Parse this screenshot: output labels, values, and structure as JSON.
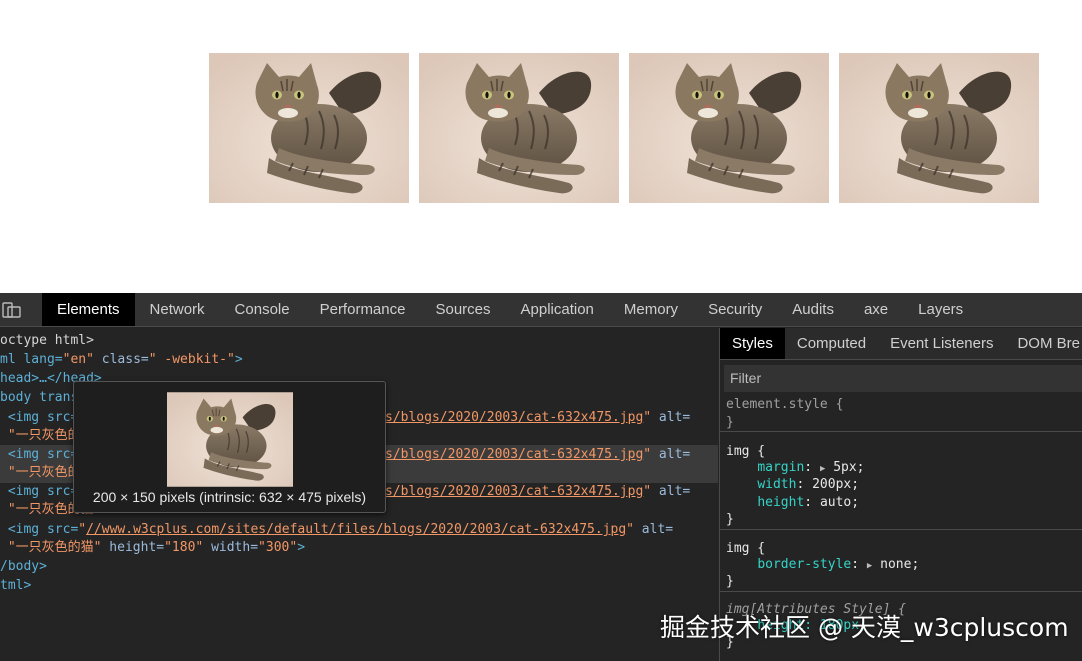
{
  "devtools": {
    "tabs": [
      "Elements",
      "Network",
      "Console",
      "Performance",
      "Sources",
      "Application",
      "Memory",
      "Security",
      "Audits",
      "axe",
      "Layers"
    ],
    "active_tab": "Elements"
  },
  "dom": {
    "line1": "octype html>",
    "line2": {
      "tag": "ml lang=",
      "lang": "\"en\"",
      "cls_attr": " class=",
      "cls_val": "\" -webkit-\"",
      "end": ">"
    },
    "line3": "head>…</head>",
    "line4": "body trans",
    "img_open": "<img src=",
    "img_src_prefix": "\"",
    "url_visible_tail": "s/blogs/2020/2003/cat-632x475.jpg",
    "url_full": "//www.w3cplus.com/sites/default/files/blogs/2020/2003/cat-632x475.jpg",
    "alt_attr": " alt=",
    "alt_line_start": "\"一只灰色的",
    "alt_full": "\"一只灰色的猫\"",
    "height_attr": " height=",
    "height_val": "\"180\"",
    "width_attr": " width=",
    "width_val": "\"300\"",
    "partial_line": "\"一只灰色的猫\" widt",
    "partial_val": "\"300\"",
    "end_body": "/body>",
    "end_html": "tml>",
    "close": ">"
  },
  "tooltip": {
    "caption": "200 × 150 pixels (intrinsic: 632 × 475 pixels)"
  },
  "styles": {
    "subtabs": [
      "Styles",
      "Computed",
      "Event Listeners",
      "DOM Bre"
    ],
    "active_subtab": "Styles",
    "filter_placeholder": "Filter",
    "element_style": "element.style {",
    "close_brace": "}",
    "rule1_selector": "img {",
    "rule1_props": [
      {
        "name": "margin",
        "value": "5px;",
        "tri": true
      },
      {
        "name": "width",
        "value": "200px;",
        "tri": false
      },
      {
        "name": "height",
        "value": "auto;",
        "tri": false
      }
    ],
    "rule2_selector": "img {",
    "rule2_prop": {
      "name": "border-style",
      "value": "none;"
    },
    "rule3_selector": "img[Attributes Style] {",
    "rule3_prop": "height: 180px;"
  },
  "watermark": "掘金技术社区 @ 天漠_w3cpluscom"
}
